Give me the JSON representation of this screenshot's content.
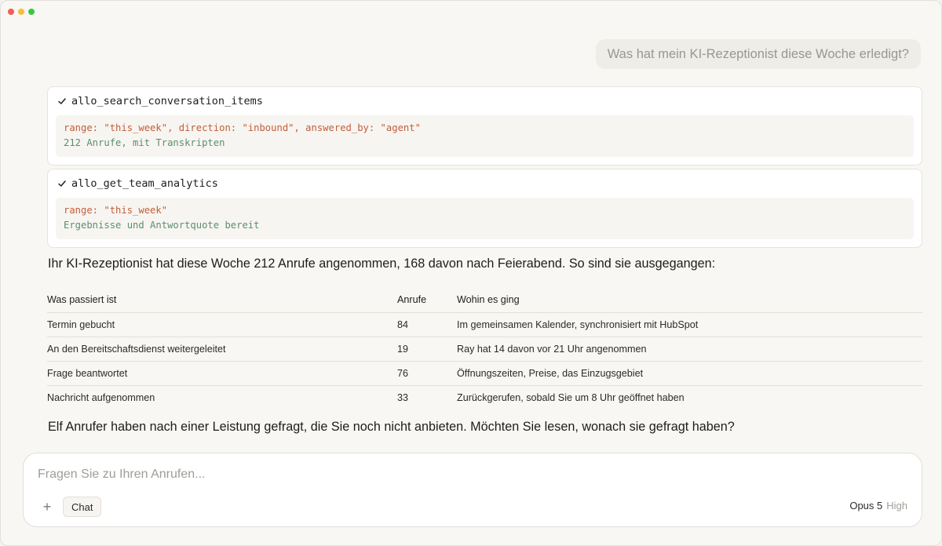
{
  "user_message": "Was hat mein KI-Rezeptionist diese Woche erledigt?",
  "tool_calls": [
    {
      "name": "allo_search_conversation_items",
      "args": "range: \"this_week\", direction: \"inbound\", answered_by: \"agent\"",
      "result": "212 Anrufe, mit Transkripten"
    },
    {
      "name": "allo_get_team_analytics",
      "args": "range: \"this_week\"",
      "result": "Ergebnisse und Antwortquote bereit"
    }
  ],
  "answer": {
    "intro": "Ihr KI-Rezeptionist hat diese Woche 212 Anrufe angenommen, 168 davon nach Feierabend. So sind sie ausgegangen:",
    "outro": "Elf Anrufer haben nach einer Leistung gefragt, die Sie noch nicht anbieten. Möchten Sie lesen, wonach sie gefragt haben?"
  },
  "table": {
    "headers": [
      "Was passiert ist",
      "Anrufe",
      "Wohin es ging"
    ],
    "rows": [
      [
        "Termin gebucht",
        "84",
        "Im gemeinsamen Kalender, synchronisiert mit HubSpot"
      ],
      [
        "An den Bereitschaftsdienst weitergeleitet",
        "19",
        "Ray hat 14 davon vor 21 Uhr angenommen"
      ],
      [
        "Frage beantwortet",
        "76",
        "Öffnungszeiten, Preise, das Einzugsgebiet"
      ],
      [
        "Nachricht aufgenommen",
        "33",
        "Zurückgerufen, sobald Sie um 8 Uhr geöffnet haben"
      ]
    ]
  },
  "composer": {
    "placeholder": "Fragen Sie zu Ihren Anrufen...",
    "value": "",
    "plus_label": "+",
    "mode_label": "Chat",
    "model_name": "Opus 5",
    "model_effort": "High"
  },
  "colors": {
    "accent_green": "#5b8f6f",
    "args_orange": "#c05f3c",
    "background": "#f8f7f3"
  },
  "icons": {
    "tool_status": "check-icon",
    "add": "plus-icon"
  }
}
